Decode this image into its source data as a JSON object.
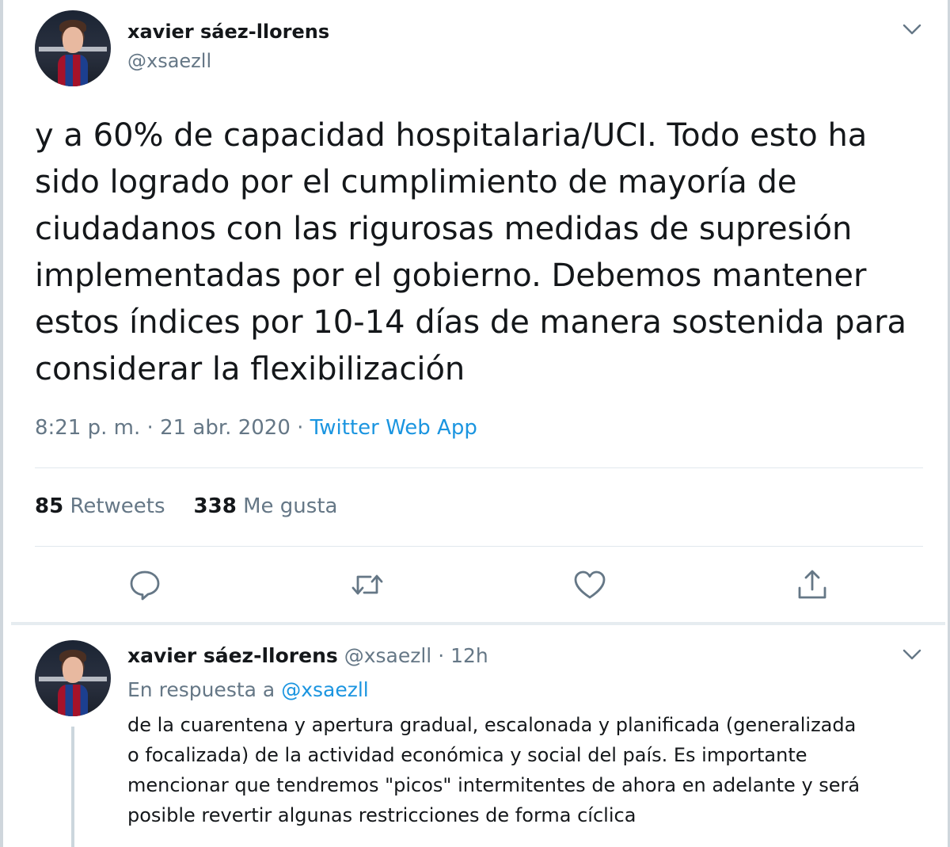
{
  "main_tweet": {
    "author_name": "xavier sáez-llorens",
    "author_handle": "@xsaezll",
    "text_lines": [
      "y a 60% de capacidad hospitalaria/UCI. Todo esto ha",
      "sido logrado por el cumplimiento de mayoría de",
      "ciudadanos con las rigurosas medidas de supresión",
      "implementadas por el gobierno. Debemos mantener",
      "estos índices por 10-14 días de manera sostenida para",
      "considerar la flexibilización"
    ],
    "time": "8:21 p. m.",
    "separator": " · ",
    "date": "21 abr. 2020",
    "source": "Twitter Web App",
    "retweets_count": "85",
    "retweets_label": "Retweets",
    "likes_count": "338",
    "likes_label": "Me gusta"
  },
  "actions": {
    "icons": [
      "reply-icon",
      "retweet-icon",
      "like-icon",
      "share-icon"
    ],
    "accent_color": "#657786"
  },
  "reply_tweet": {
    "author_name": "xavier sáez-llorens",
    "author_handle": "@xsaezll",
    "separator": "·",
    "time_ago": "12h",
    "reply_prefix": "En respuesta a",
    "reply_mention": "@xsaezll",
    "text_lines": [
      "de la cuarentena y apertura gradual, escalonada y planificada (generalizada",
      "o focalizada) de la actividad económica y social del país. Es importante",
      "mencionar que tendremos \"picos\" intermitentes de ahora en adelante y será",
      "posible revertir algunas restricciones de forma cíclica"
    ]
  },
  "colors": {
    "text_primary": "#14171a",
    "text_secondary": "#657786",
    "link": "#1b95e0",
    "divider": "#e1e8ed"
  }
}
